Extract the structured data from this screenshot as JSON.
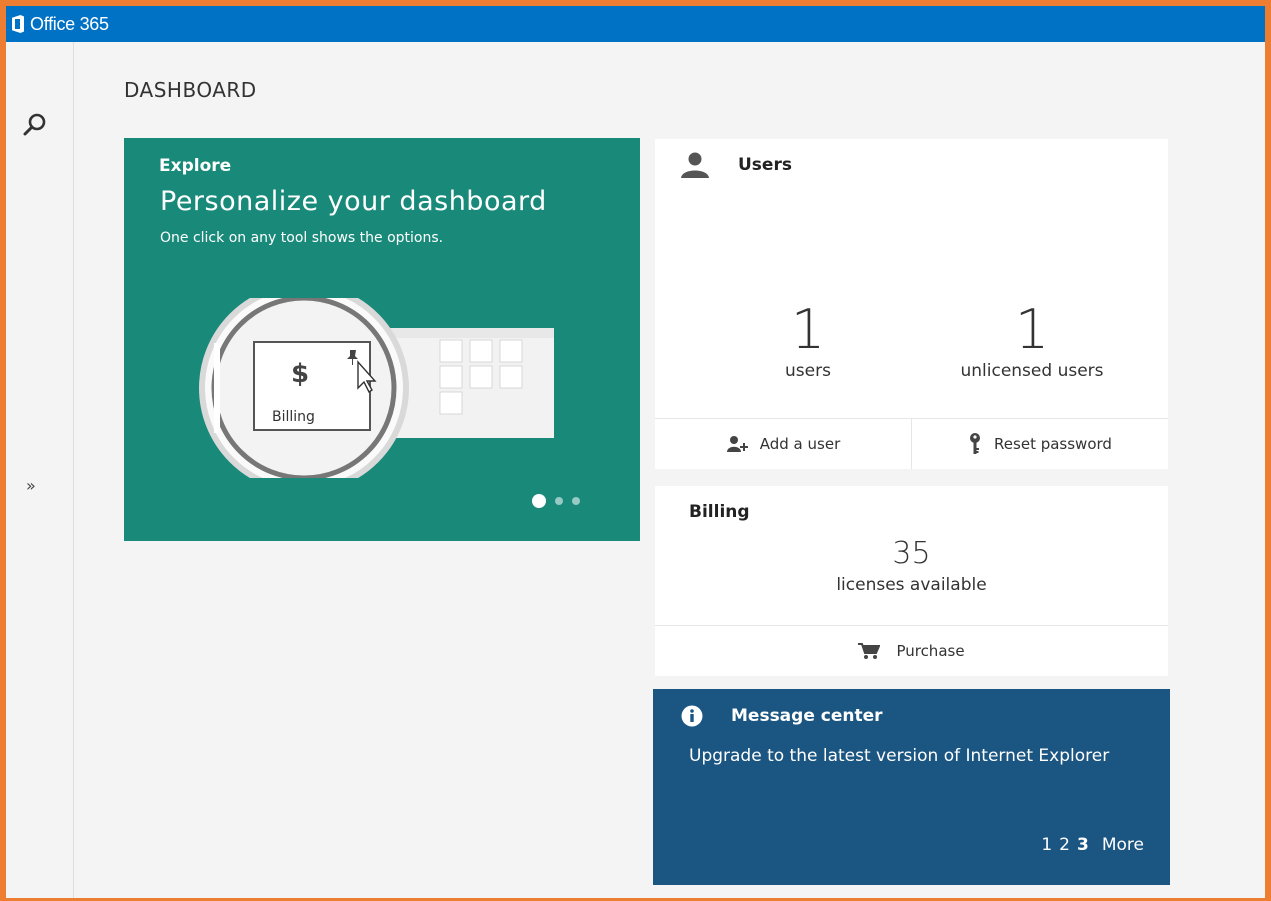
{
  "app": {
    "title": "Office 365"
  },
  "page": {
    "title": "DASHBOARD"
  },
  "explore": {
    "label": "Explore",
    "heading": "Personalize your dashboard",
    "subtext": "One click on any tool shows the options.",
    "illustration_label": "Billing",
    "illustration_symbol": "$",
    "carousel": {
      "count": 3,
      "active_index": 0
    }
  },
  "users_tile": {
    "title": "Users",
    "users_count": "1",
    "users_label": "users",
    "unlicensed_count": "1",
    "unlicensed_label": "unlicensed users",
    "add_user_label": "Add a user",
    "reset_password_label": "Reset password"
  },
  "billing_tile": {
    "title": "Billing",
    "licenses_count": "35",
    "licenses_label": "licenses available",
    "purchase_label": "Purchase"
  },
  "message_center": {
    "title": "Message center",
    "message": "Upgrade to the latest version of Internet Explorer",
    "pages": [
      "1",
      "2",
      "3"
    ],
    "current_page": "3",
    "more_label": "More"
  },
  "colors": {
    "topbar": "#0072C6",
    "explore_tile": "#198A7A",
    "message_tile": "#1B5581",
    "frame_border": "#ED7D31"
  },
  "icons": {
    "search": "search-icon",
    "expand": "chevron-double-right-icon",
    "users": "person-icon",
    "add_user": "add-person-icon",
    "reset_password": "key-icon",
    "purchase": "cart-icon",
    "message": "info-icon"
  }
}
